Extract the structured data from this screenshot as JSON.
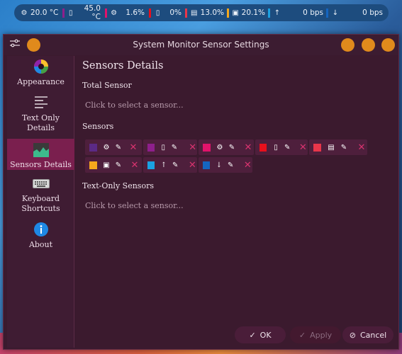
{
  "panel": {
    "items": [
      {
        "icon": "cpu-temp-icon",
        "glyph": "⚙",
        "color": "",
        "value": "20.0 °C"
      },
      {
        "icon": "gpu-temp-icon",
        "glyph": "▯",
        "color": "#8e1f8c",
        "value": "45.0 °C"
      },
      {
        "icon": "cpu-usage-icon",
        "glyph": "⚙",
        "color": "#e0136b",
        "value": "1.6%"
      },
      {
        "icon": "gpu-usage-icon",
        "glyph": "▯",
        "color": "#e8101c",
        "value": "0%"
      },
      {
        "icon": "memory-icon",
        "glyph": "▤",
        "color": "#e8364a",
        "value": "13.0%"
      },
      {
        "icon": "disk-icon",
        "glyph": "▣",
        "color": "#f5a81c",
        "value": "20.1%"
      },
      {
        "icon": "upload-icon",
        "glyph": "↑",
        "color": "#1ba1e2",
        "value": "0 bps"
      },
      {
        "icon": "download-icon",
        "glyph": "↓",
        "color": "#1565c0",
        "value": "0 bps"
      }
    ]
  },
  "window": {
    "title": "System Monitor Sensor Settings",
    "button_color": "#e08a1c"
  },
  "sidebar": {
    "items": [
      {
        "label": "Appearance",
        "icon": "appearance-icon",
        "active": false
      },
      {
        "label": "Text Only Details",
        "icon": "text-details-icon",
        "active": false
      },
      {
        "label": "Sensors Details",
        "icon": "sensors-details-icon",
        "active": true
      },
      {
        "label": "Keyboard Shortcuts",
        "icon": "keyboard-icon",
        "active": false
      },
      {
        "label": "About",
        "icon": "info-icon",
        "active": false
      }
    ]
  },
  "content": {
    "title": "Sensors Details",
    "total_sensor_label": "Total Sensor",
    "total_sensor_placeholder": "Click to select a sensor...",
    "sensors_label": "Sensors",
    "text_only_label": "Text-Only Sensors",
    "text_only_placeholder": "Click to select a sensor...",
    "sensors": [
      {
        "color": "#5b2a86",
        "icon": "cpu-icon",
        "glyph": "⚙"
      },
      {
        "color": "#8e1f8c",
        "icon": "gpu-icon",
        "glyph": "▯"
      },
      {
        "color": "#e0136b",
        "icon": "cpu-icon",
        "glyph": "⚙"
      },
      {
        "color": "#e8101c",
        "icon": "gpu-icon",
        "glyph": "▯"
      },
      {
        "color": "#e8364a",
        "icon": "memory-icon",
        "glyph": "▤"
      },
      {
        "color": "#f5a81c",
        "icon": "disk-icon",
        "glyph": "▣"
      },
      {
        "color": "#1ba1e2",
        "icon": "upload-icon",
        "glyph": "↑"
      },
      {
        "color": "#1565c0",
        "icon": "download-icon",
        "glyph": "↓"
      }
    ]
  },
  "buttons": {
    "ok": "OK",
    "apply": "Apply",
    "cancel": "Cancel"
  }
}
